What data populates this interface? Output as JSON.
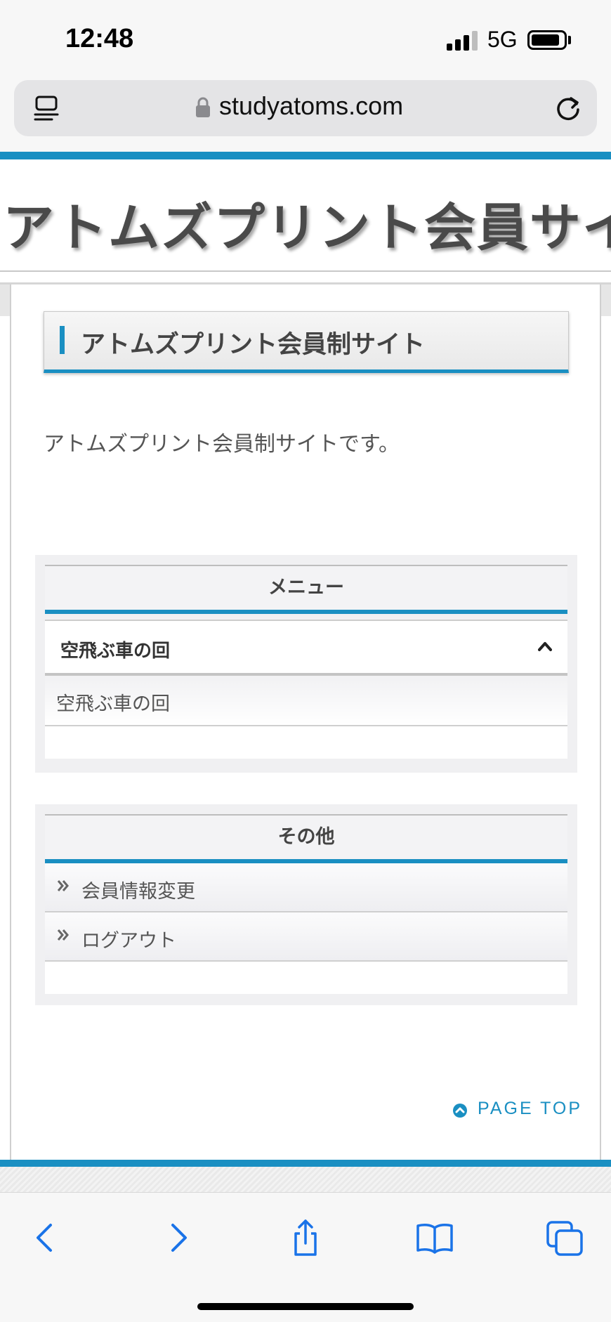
{
  "status_bar": {
    "time": "12:48",
    "network": "5G",
    "signal_bars_active": 3,
    "signal_bars_total": 4
  },
  "browser": {
    "url": "studyatoms.com"
  },
  "site": {
    "title": "アトムズプリント会員サイト",
    "heading": "アトムズプリント会員制サイト",
    "intro": "アトムズプリント会員制サイトです。"
  },
  "menu": {
    "title": "メニュー",
    "accordion_label": "空飛ぶ車の回",
    "accordion_expanded": true,
    "items": [
      {
        "label": "空飛ぶ車の回"
      }
    ]
  },
  "other": {
    "title": "その他",
    "links": [
      {
        "label": "会員情報変更"
      },
      {
        "label": "ログアウト"
      }
    ]
  },
  "page_top": {
    "label": "PAGE TOP"
  },
  "colors": {
    "accent": "#1a8fc2",
    "ios_blue": "#1a73e8"
  }
}
